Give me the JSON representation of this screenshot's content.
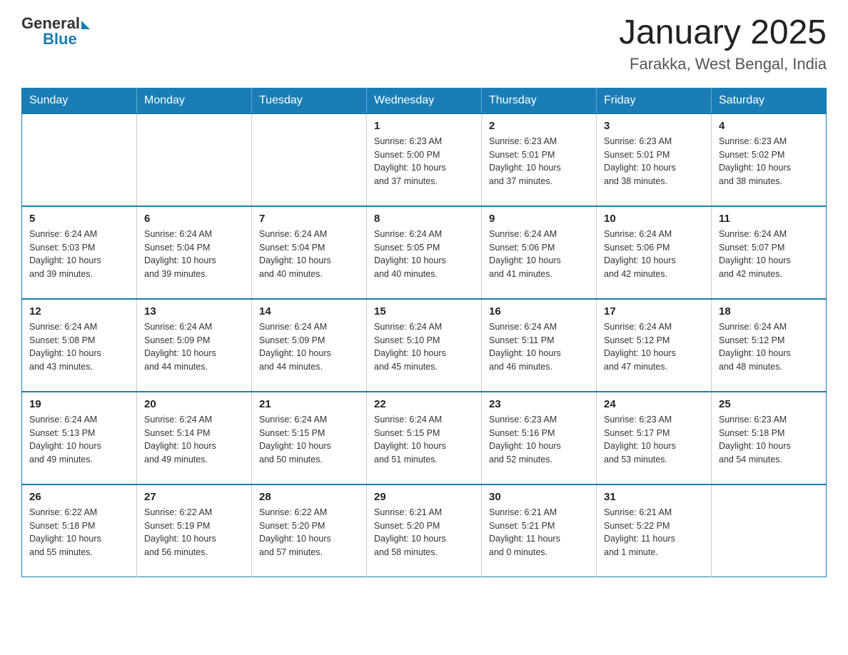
{
  "header": {
    "logo": {
      "general": "General",
      "blue": "Blue"
    },
    "title": "January 2025",
    "location": "Farakka, West Bengal, India"
  },
  "days_of_week": [
    "Sunday",
    "Monday",
    "Tuesday",
    "Wednesday",
    "Thursday",
    "Friday",
    "Saturday"
  ],
  "weeks": [
    [
      {
        "day": "",
        "info": ""
      },
      {
        "day": "",
        "info": ""
      },
      {
        "day": "",
        "info": ""
      },
      {
        "day": "1",
        "info": "Sunrise: 6:23 AM\nSunset: 5:00 PM\nDaylight: 10 hours\nand 37 minutes."
      },
      {
        "day": "2",
        "info": "Sunrise: 6:23 AM\nSunset: 5:01 PM\nDaylight: 10 hours\nand 37 minutes."
      },
      {
        "day": "3",
        "info": "Sunrise: 6:23 AM\nSunset: 5:01 PM\nDaylight: 10 hours\nand 38 minutes."
      },
      {
        "day": "4",
        "info": "Sunrise: 6:23 AM\nSunset: 5:02 PM\nDaylight: 10 hours\nand 38 minutes."
      }
    ],
    [
      {
        "day": "5",
        "info": "Sunrise: 6:24 AM\nSunset: 5:03 PM\nDaylight: 10 hours\nand 39 minutes."
      },
      {
        "day": "6",
        "info": "Sunrise: 6:24 AM\nSunset: 5:04 PM\nDaylight: 10 hours\nand 39 minutes."
      },
      {
        "day": "7",
        "info": "Sunrise: 6:24 AM\nSunset: 5:04 PM\nDaylight: 10 hours\nand 40 minutes."
      },
      {
        "day": "8",
        "info": "Sunrise: 6:24 AM\nSunset: 5:05 PM\nDaylight: 10 hours\nand 40 minutes."
      },
      {
        "day": "9",
        "info": "Sunrise: 6:24 AM\nSunset: 5:06 PM\nDaylight: 10 hours\nand 41 minutes."
      },
      {
        "day": "10",
        "info": "Sunrise: 6:24 AM\nSunset: 5:06 PM\nDaylight: 10 hours\nand 42 minutes."
      },
      {
        "day": "11",
        "info": "Sunrise: 6:24 AM\nSunset: 5:07 PM\nDaylight: 10 hours\nand 42 minutes."
      }
    ],
    [
      {
        "day": "12",
        "info": "Sunrise: 6:24 AM\nSunset: 5:08 PM\nDaylight: 10 hours\nand 43 minutes."
      },
      {
        "day": "13",
        "info": "Sunrise: 6:24 AM\nSunset: 5:09 PM\nDaylight: 10 hours\nand 44 minutes."
      },
      {
        "day": "14",
        "info": "Sunrise: 6:24 AM\nSunset: 5:09 PM\nDaylight: 10 hours\nand 44 minutes."
      },
      {
        "day": "15",
        "info": "Sunrise: 6:24 AM\nSunset: 5:10 PM\nDaylight: 10 hours\nand 45 minutes."
      },
      {
        "day": "16",
        "info": "Sunrise: 6:24 AM\nSunset: 5:11 PM\nDaylight: 10 hours\nand 46 minutes."
      },
      {
        "day": "17",
        "info": "Sunrise: 6:24 AM\nSunset: 5:12 PM\nDaylight: 10 hours\nand 47 minutes."
      },
      {
        "day": "18",
        "info": "Sunrise: 6:24 AM\nSunset: 5:12 PM\nDaylight: 10 hours\nand 48 minutes."
      }
    ],
    [
      {
        "day": "19",
        "info": "Sunrise: 6:24 AM\nSunset: 5:13 PM\nDaylight: 10 hours\nand 49 minutes."
      },
      {
        "day": "20",
        "info": "Sunrise: 6:24 AM\nSunset: 5:14 PM\nDaylight: 10 hours\nand 49 minutes."
      },
      {
        "day": "21",
        "info": "Sunrise: 6:24 AM\nSunset: 5:15 PM\nDaylight: 10 hours\nand 50 minutes."
      },
      {
        "day": "22",
        "info": "Sunrise: 6:24 AM\nSunset: 5:15 PM\nDaylight: 10 hours\nand 51 minutes."
      },
      {
        "day": "23",
        "info": "Sunrise: 6:23 AM\nSunset: 5:16 PM\nDaylight: 10 hours\nand 52 minutes."
      },
      {
        "day": "24",
        "info": "Sunrise: 6:23 AM\nSunset: 5:17 PM\nDaylight: 10 hours\nand 53 minutes."
      },
      {
        "day": "25",
        "info": "Sunrise: 6:23 AM\nSunset: 5:18 PM\nDaylight: 10 hours\nand 54 minutes."
      }
    ],
    [
      {
        "day": "26",
        "info": "Sunrise: 6:22 AM\nSunset: 5:18 PM\nDaylight: 10 hours\nand 55 minutes."
      },
      {
        "day": "27",
        "info": "Sunrise: 6:22 AM\nSunset: 5:19 PM\nDaylight: 10 hours\nand 56 minutes."
      },
      {
        "day": "28",
        "info": "Sunrise: 6:22 AM\nSunset: 5:20 PM\nDaylight: 10 hours\nand 57 minutes."
      },
      {
        "day": "29",
        "info": "Sunrise: 6:21 AM\nSunset: 5:20 PM\nDaylight: 10 hours\nand 58 minutes."
      },
      {
        "day": "30",
        "info": "Sunrise: 6:21 AM\nSunset: 5:21 PM\nDaylight: 11 hours\nand 0 minutes."
      },
      {
        "day": "31",
        "info": "Sunrise: 6:21 AM\nSunset: 5:22 PM\nDaylight: 11 hours\nand 1 minute."
      },
      {
        "day": "",
        "info": ""
      }
    ]
  ]
}
